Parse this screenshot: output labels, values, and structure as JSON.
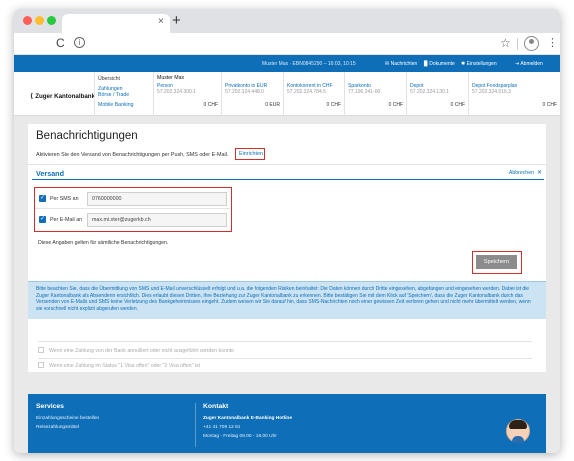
{
  "browser": {
    "new_tab": "+",
    "tab_close": "×",
    "reload": "C",
    "info": "ⓘ",
    "star": "☆",
    "menu": "⋮",
    "dots_colors": [
      "#ff5f57",
      "#febc2e",
      "#28c840"
    ]
  },
  "topbar": {
    "user_info": "Muster Max  ·  EBN0845290 – 16:03, 10:15",
    "links": [
      "Nachrichten",
      "Dokumente",
      "Einstellungen",
      "Abmelden"
    ],
    "icons": [
      "mail-icon",
      "document-icon",
      "gear-icon",
      "logout-icon"
    ]
  },
  "logo": {
    "mark": "⟨",
    "text": "Zuger Kantonalbank"
  },
  "menu": {
    "items": [
      "Übersicht",
      "Zahlungen",
      "Börse / Trade",
      "Mobile Banking"
    ],
    "user_label": "Muster Max"
  },
  "accounts": [
    {
      "name": "Person",
      "number": "57.202.324.300.1",
      "balance": "0 CHF"
    },
    {
      "name": "Privatkonto in EUR",
      "number": "57.202.324.448.0",
      "balance": "0 EUR"
    },
    {
      "name": "Kontokorrent in CHF",
      "number": "57.202.324.784.5",
      "balance": "0 CHF"
    },
    {
      "name": "Sparkonto",
      "number": "77.196.341-00",
      "balance": "0 CHF"
    },
    {
      "name": "Depot",
      "number": "57.202.324.130.1",
      "balance": "0 CHF"
    },
    {
      "name": "Depot Fondsparplan",
      "number": "57.202.324.516.3",
      "balance": "0 CHF"
    }
  ],
  "page": {
    "title": "Benachrichtigungen",
    "subtitle": "Aktivieren Sie den Versand von Benachrichtigungen per Push, SMS oder E-Mail.",
    "activate_link": "Einrichten"
  },
  "section": {
    "title": "Versand",
    "cancel": "Abbrechen",
    "close": "✕",
    "sms": {
      "label": "Per SMS an",
      "checked": true,
      "value": "0760000000",
      "check": "✓"
    },
    "email": {
      "label": "Per E-Mail an",
      "checked": true,
      "value": "max.mi.ster@zugerkb.ch",
      "check": "✓"
    },
    "note": "Diese Angaben gelten für sämtliche Benachrichtigungen.",
    "save": "Speichern"
  },
  "info_text": "Bitte beachten Sie, dass die Übermittlung von SMS und E-Mail unverschlüsselt erfolgt und u.a. die folgenden Risiken beinhaltet: Die Daten können durch Dritte eingesehen, abgefangen und eingesehen werden. Dabei ist die Zuger Kantonalbank als Absenderin ersichtlich. Dies erlaubt diesen Dritten, Ihre Beziehung zur Zuger Kantonalbank zu erkennen. Bitte bestätigen Sie mit dem Klick auf 'Speichern', dass die Zuger Kantonalbank durch das Versenden von E-Mails und SMS keine Verletzung des Bankgeheimnisses eingeht. Zudem weisen wir Sie darauf hin, dass SMS-Nachrichten noch einer gewissen Zeit verloren gehen und nicht mehr übermittelt werden, wenn sie vorschnell nicht explizit abgerufen werden.",
  "options": [
    "Wenn eine Zahlung von der Bank annulliert oder nicht ausgeführt werden konnte",
    "Wenn eine Zahlung im Status \"1 Visa offen\" oder \"2 Visa offen\" ist"
  ],
  "footer": {
    "services_title": "Services",
    "services": [
      "Einzahlungsscheine bestellen",
      "Reisezahlungsmittel"
    ],
    "contact_title": "Kontakt",
    "contact": [
      "Zuger Kantonalbank E-Banking Hotline",
      "+41 41 709 12 61",
      "Montag - Freitag 08.00 - 18.00 Uhr"
    ]
  },
  "colors": {
    "accent": "#0e6fb8",
    "highlight": "#d32f2f",
    "page_bg": "#e9e9e9"
  }
}
